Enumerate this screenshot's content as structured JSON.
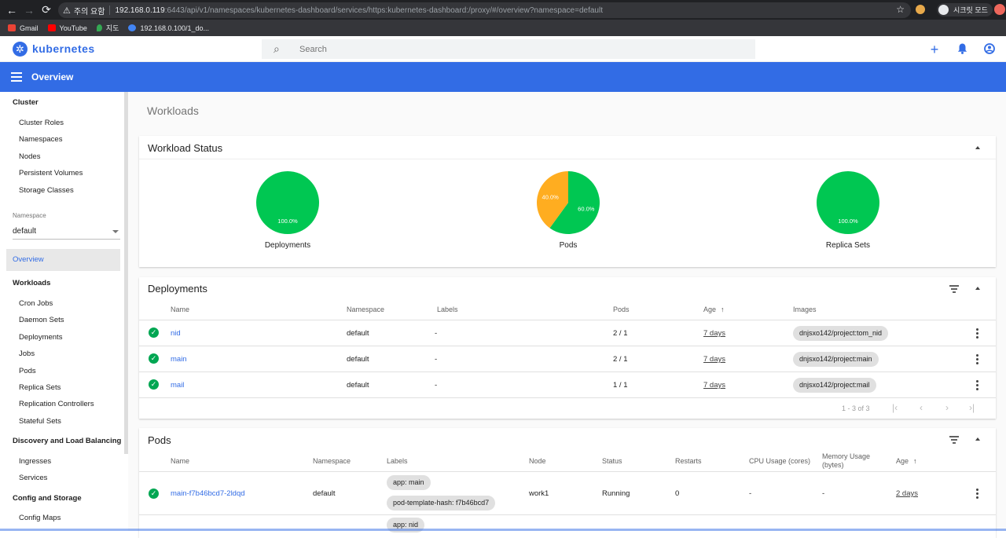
{
  "browser": {
    "back": "←",
    "forward": "→",
    "reload": "⟳",
    "security_icon": "warning-icon",
    "security_text": "주의 요함",
    "url_host": "192.168.0.119",
    "url_rest": ":6443/api/v1/namespaces/kubernetes-dashboard/services/https:kubernetes-dashboard:/proxy/#/overview?namespace=default",
    "star": "☆",
    "incognito_label": "시크릿 모드"
  },
  "bookmarks": [
    {
      "label": "Gmail",
      "color": "#ea4335"
    },
    {
      "label": "YouTube",
      "color": "#ff0000"
    },
    {
      "label": "지도",
      "color": "#34a853"
    },
    {
      "label": "192.168.0.100/1_do...",
      "color": "#4285f4"
    }
  ],
  "header": {
    "logo_glyph": "✲",
    "brand": "kubernetes",
    "search_placeholder": "Search",
    "search_icon": "⌕",
    "plus_icon": "+",
    "bell_icon": "🔔",
    "account_icon": "◉"
  },
  "toolbar": {
    "title": "Overview"
  },
  "sidebar": {
    "cluster": "Cluster",
    "cluster_items": [
      "Cluster Roles",
      "Namespaces",
      "Nodes",
      "Persistent Volumes",
      "Storage Classes"
    ],
    "namespace_label": "Namespace",
    "namespace_value": "default",
    "overview": "Overview",
    "workloads": "Workloads",
    "workload_items": [
      "Cron Jobs",
      "Daemon Sets",
      "Deployments",
      "Jobs",
      "Pods",
      "Replica Sets",
      "Replication Controllers",
      "Stateful Sets"
    ],
    "discovery": "Discovery and Load Balancing",
    "discovery_items": [
      "Ingresses",
      "Services"
    ],
    "config": "Config and Storage",
    "config_items": [
      "Config Maps"
    ]
  },
  "main": {
    "heading": "Workloads",
    "status_title": "Workload Status",
    "deployments_title": "Deployments",
    "pods_title": "Pods"
  },
  "colors": {
    "success": "#00c752",
    "pending": "#ffad20",
    "accent": "#326ce5"
  },
  "chart_data": [
    {
      "type": "pie",
      "title": "Deployments",
      "slices": [
        {
          "name": "running",
          "value": 100.0,
          "label": "100.0%"
        }
      ]
    },
    {
      "type": "pie",
      "title": "Pods",
      "slices": [
        {
          "name": "running",
          "value": 60.0,
          "label": "60.0%"
        },
        {
          "name": "pending",
          "value": 40.0,
          "label": "40.0%"
        }
      ]
    },
    {
      "type": "pie",
      "title": "Replica Sets",
      "slices": [
        {
          "name": "running",
          "value": 100.0,
          "label": "100.0%"
        }
      ]
    }
  ],
  "deployments": {
    "columns": [
      "Name",
      "Namespace",
      "Labels",
      "Pods",
      "Age",
      "Images"
    ],
    "sort_arrow": "↑",
    "rows": [
      {
        "name": "nid",
        "namespace": "default",
        "labels": "-",
        "pods": "2 / 1",
        "age": "7 days",
        "image": "dnjsxo142/project:tom_nid"
      },
      {
        "name": "main",
        "namespace": "default",
        "labels": "-",
        "pods": "2 / 1",
        "age": "7 days",
        "image": "dnjsxo142/project:main"
      },
      {
        "name": "mail",
        "namespace": "default",
        "labels": "-",
        "pods": "1 / 1",
        "age": "7 days",
        "image": "dnjsxo142/project:mail"
      }
    ],
    "pager": "1 - 3 of 3",
    "pager_buttons": [
      "|‹",
      "‹",
      "›",
      "›|"
    ]
  },
  "pods": {
    "columns": [
      "Name",
      "Namespace",
      "Labels",
      "Node",
      "Status",
      "Restarts",
      "CPU Usage (cores)",
      "Memory Usage (bytes)",
      "Age"
    ],
    "sort_arrow": "↑",
    "rows": [
      {
        "name": "main-f7b46bcd7-2ldqd",
        "namespace": "default",
        "labels": [
          "app: main",
          "pod-template-hash: f7b46bcd7"
        ],
        "node": "work1",
        "status": "Running",
        "restarts": "0",
        "cpu": "-",
        "memory": "-",
        "age": "2 days"
      },
      {
        "name": "",
        "namespace": "",
        "labels": [
          "app: nid"
        ],
        "node": "",
        "status": "",
        "restarts": "",
        "cpu": "",
        "memory": "",
        "age": ""
      }
    ]
  },
  "row_status_icon": "✓"
}
